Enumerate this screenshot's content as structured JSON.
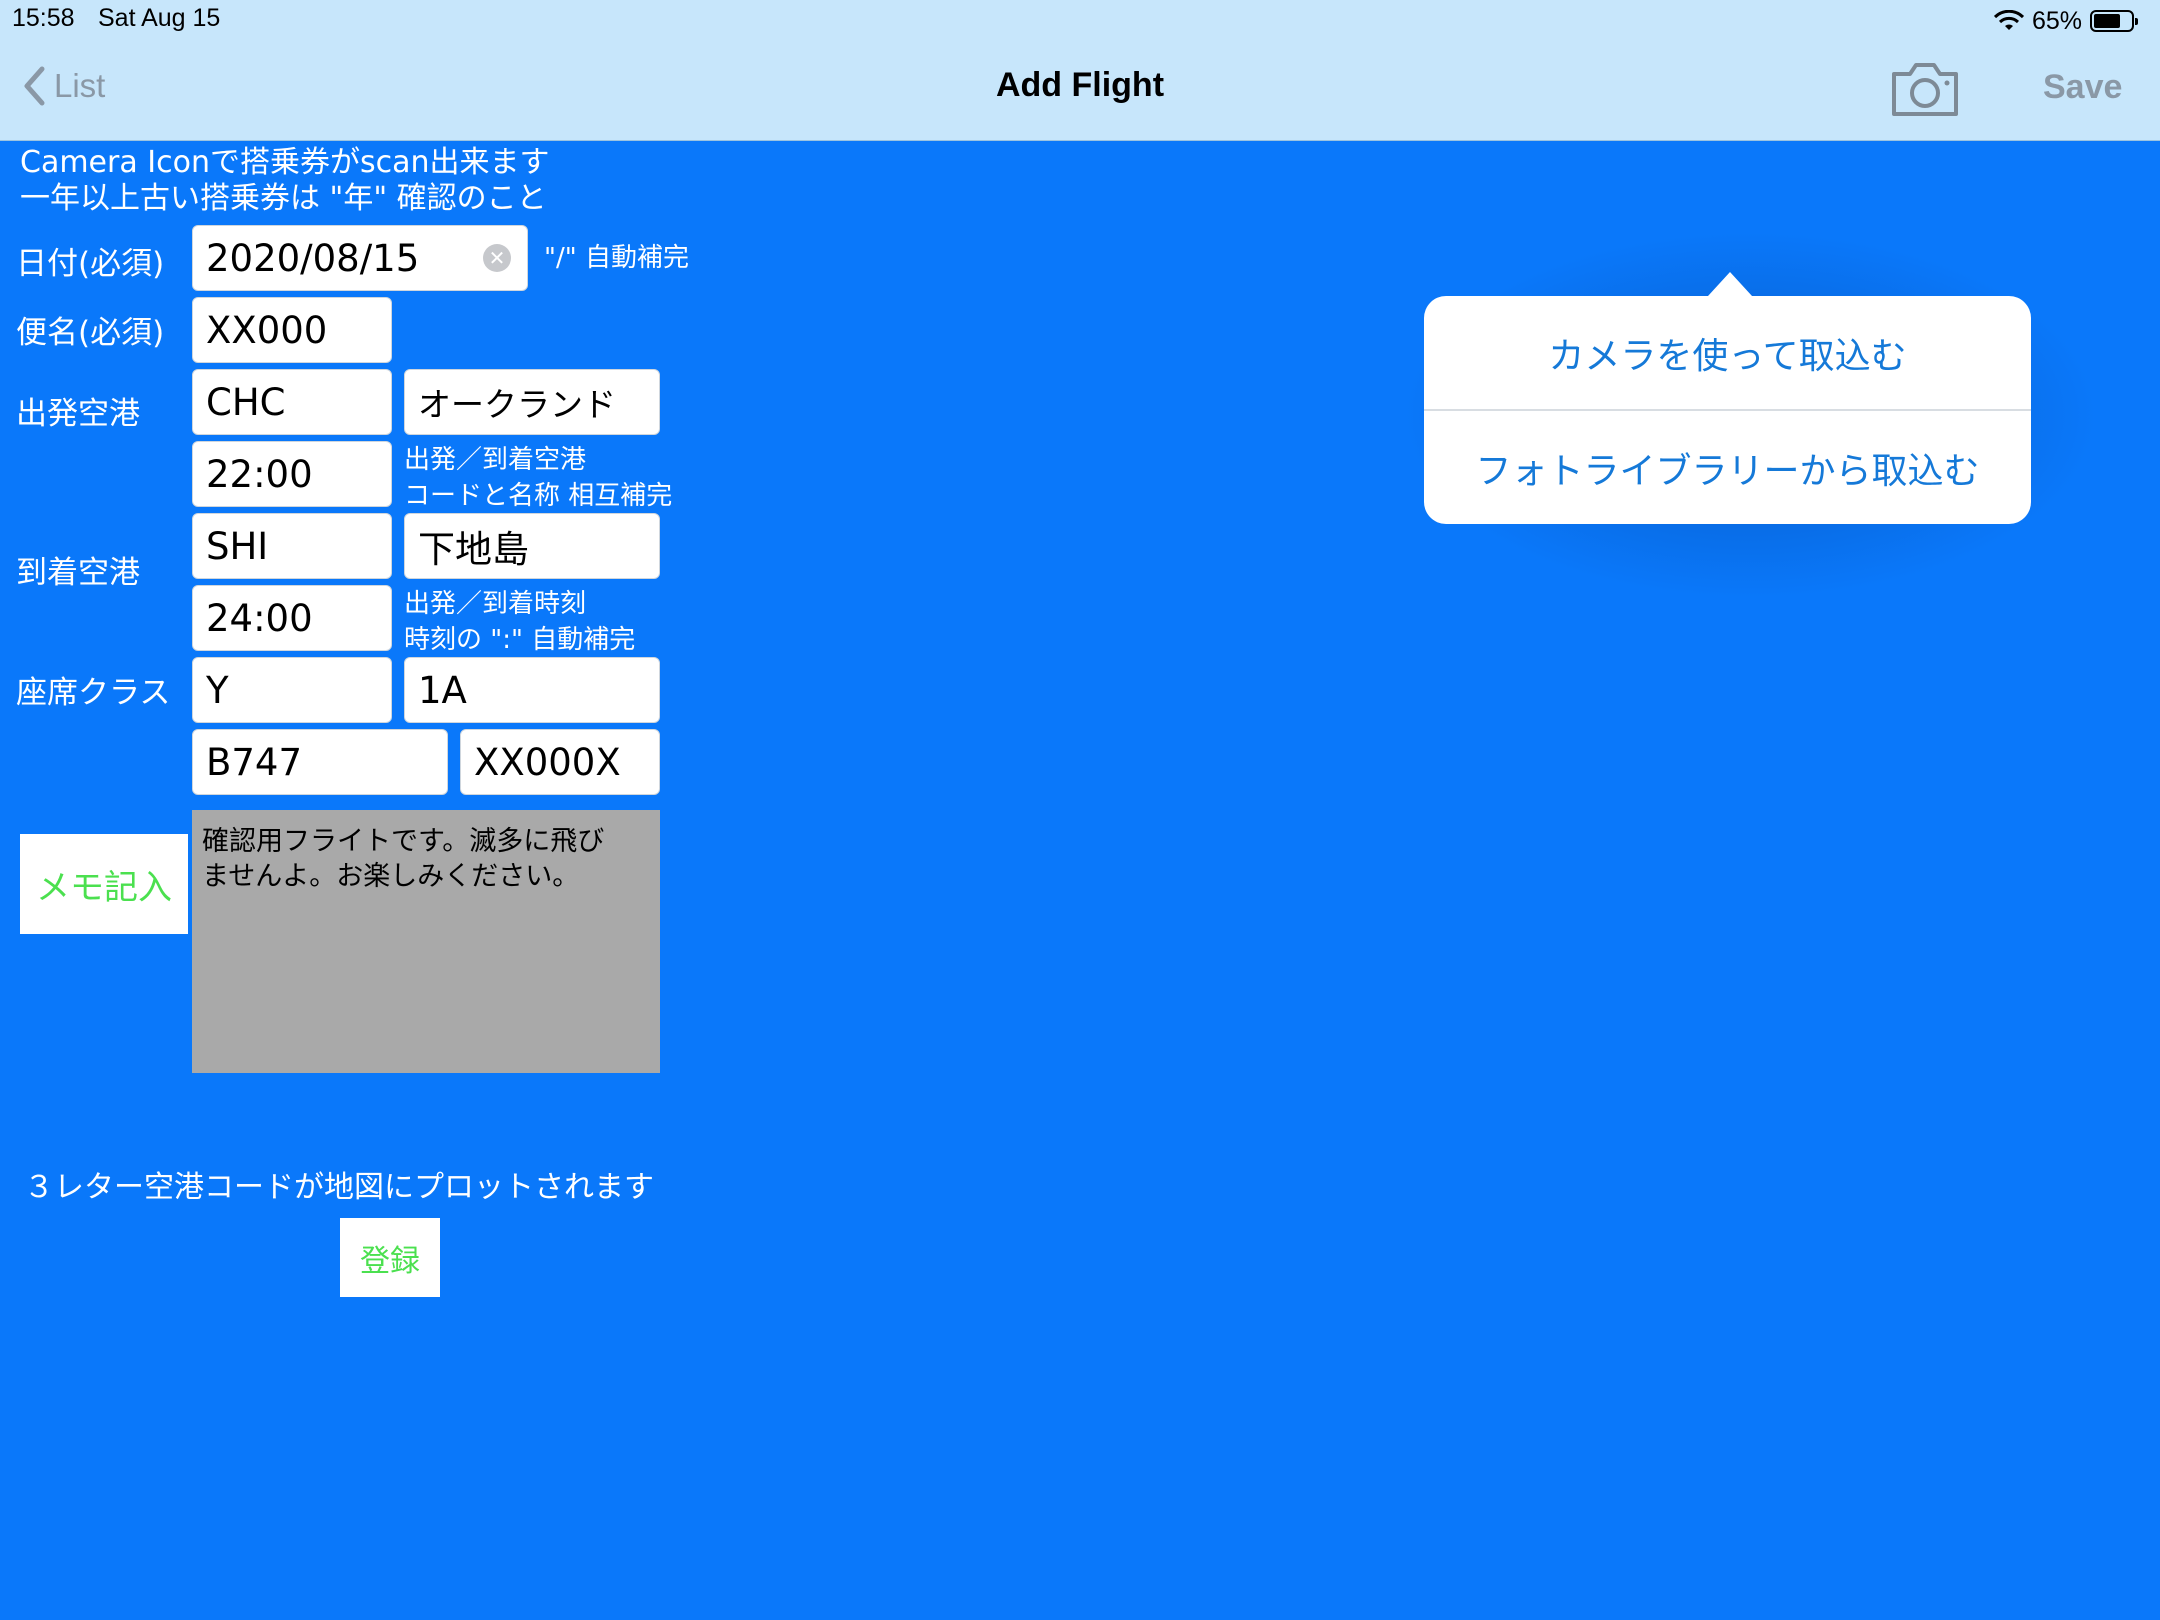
{
  "status": {
    "time": "15:58",
    "date": "Sat Aug 15",
    "battery": "65%"
  },
  "nav": {
    "back_label": "List",
    "title": "Add Flight",
    "save_label": "Save"
  },
  "notes": {
    "line1": "Camera Iconで搭乗券がscan出来ます",
    "line2": "一年以上古い搭乗券は \"年\" 確認のこと"
  },
  "labels": {
    "date": "日付(必須)",
    "flight": "便名(必須)",
    "departure": "出発空港",
    "arrival": "到着空港",
    "seat_class": "座席クラス"
  },
  "hints": {
    "date_autofill": "\"/\" 自動補完",
    "airport_line1": "出発／到着空港",
    "airport_line2": "コードと名称 相互補完",
    "time_line1": "出発／到着時刻",
    "time_line2": "時刻の \":\" 自動補完"
  },
  "fields": {
    "date": "2020/08/15",
    "flight_no": "XX000",
    "dep_code": "CHC",
    "dep_name": "オークランド",
    "dep_time": "22:00",
    "arr_code": "SHI",
    "arr_name": "下地島",
    "arr_time": "24:00",
    "seat_class": "Y",
    "seat": "1A",
    "aircraft": "B747",
    "registration": "XX000X"
  },
  "memo": {
    "button_label": "メモ記入",
    "text_line1": "確認用フライトです。滅多に飛び",
    "text_line2": "ませんよ。お楽しみください。"
  },
  "plot_note": "３レター空港コードが地図にプロットされます",
  "register_label": "登録",
  "popover": {
    "items": [
      "カメラを使って取込む",
      "フォトライブラリーから取込む"
    ]
  }
}
